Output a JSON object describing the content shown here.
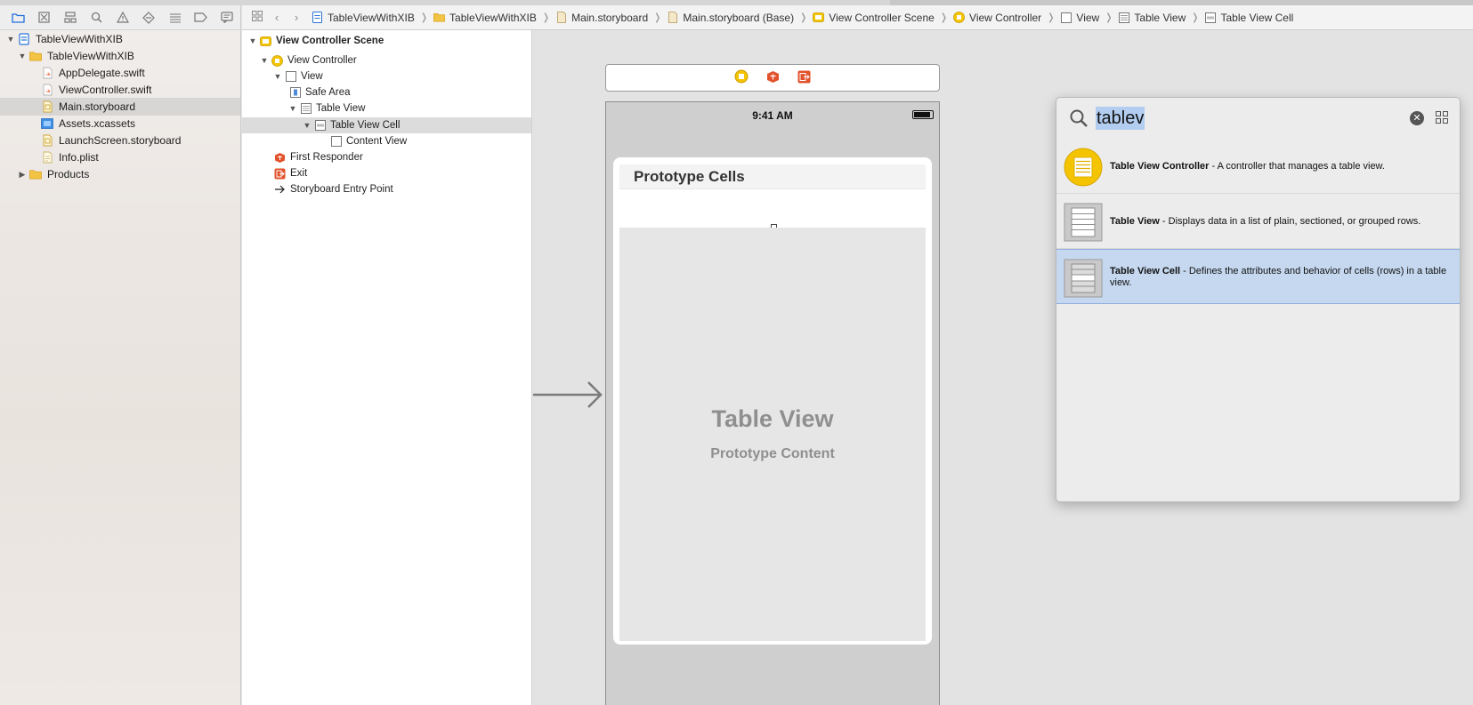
{
  "navigator": {
    "toolbar_icons": [
      "folder-icon",
      "source-control-icon",
      "symbol-icon",
      "find-icon",
      "issue-icon",
      "test-icon",
      "debug-icon",
      "breakpoint-icon",
      "report-icon"
    ],
    "tree": [
      {
        "label": "TableViewWithXIB",
        "icon": "project-icon",
        "disclosure": "▼",
        "level": 0
      },
      {
        "label": "TableViewWithXIB",
        "icon": "folder-icon",
        "disclosure": "▼",
        "level": 1
      },
      {
        "label": "AppDelegate.swift",
        "icon": "swift-file-icon",
        "disclosure": "",
        "level": 2
      },
      {
        "label": "ViewController.swift",
        "icon": "swift-file-icon",
        "disclosure": "",
        "level": 2
      },
      {
        "label": "Main.storyboard",
        "icon": "storyboard-file-icon",
        "disclosure": "",
        "level": 2,
        "selected": true
      },
      {
        "label": "Assets.xcassets",
        "icon": "assets-icon",
        "disclosure": "",
        "level": 2
      },
      {
        "label": "LaunchScreen.storyboard",
        "icon": "storyboard-file-icon",
        "disclosure": "",
        "level": 2
      },
      {
        "label": "Info.plist",
        "icon": "plist-file-icon",
        "disclosure": "",
        "level": 2
      },
      {
        "label": "Products",
        "icon": "folder-icon",
        "disclosure": "▶",
        "level": 1
      }
    ]
  },
  "breadcrumb": [
    "TableViewWithXIB",
    "TableViewWithXIB",
    "Main.storyboard",
    "Main.storyboard (Base)",
    "View Controller Scene",
    "View Controller",
    "View",
    "Table View",
    "Table View Cell"
  ],
  "outline": {
    "rows": [
      {
        "label": "View Controller Scene",
        "disclosure": "▼",
        "bold": true
      },
      {
        "label": "View Controller",
        "disclosure": "▼"
      },
      {
        "label": "View",
        "disclosure": "▼"
      },
      {
        "label": "Safe Area",
        "disclosure": ""
      },
      {
        "label": "Table View",
        "disclosure": "▼"
      },
      {
        "label": "Table View Cell",
        "disclosure": "▼",
        "selected": true
      },
      {
        "label": "Content View",
        "disclosure": ""
      },
      {
        "label": "First Responder",
        "disclosure": ""
      },
      {
        "label": "Exit",
        "disclosure": ""
      },
      {
        "label": "Storyboard Entry Point",
        "disclosure": ""
      }
    ]
  },
  "canvas": {
    "status_time": "9:41 AM",
    "prototype_header": "Prototype Cells",
    "table_title": "Table View",
    "table_subtitle": "Prototype Content"
  },
  "library": {
    "search_value": "tablev",
    "items": [
      {
        "title": "Table View Controller",
        "description": " - A controller that manages a table view.",
        "icon": "table-view-controller-icon"
      },
      {
        "title": "Table View",
        "description": " - Displays data in a list of plain, sectioned, or grouped rows.",
        "icon": "table-view-icon"
      },
      {
        "title": "Table View Cell",
        "description": " - Defines the attributes and behavior of cells (rows) in a table view.",
        "icon": "table-view-cell-icon",
        "selected": true
      }
    ]
  },
  "colors": {
    "accent": "#1f6fe0",
    "selection": "#c5d8ef",
    "controller_yellow": "#f5c400",
    "responder_red": "#e2522c"
  }
}
